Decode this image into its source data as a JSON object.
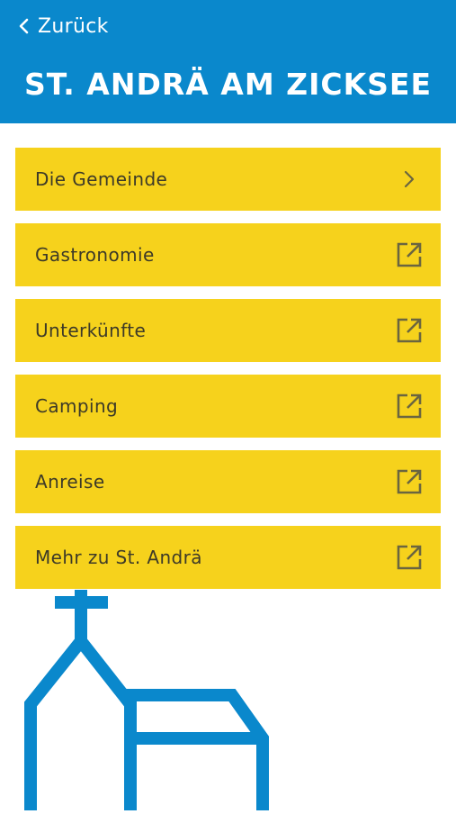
{
  "header": {
    "back_label": "Zurück",
    "title": "ST. ANDRÄ AM ZICKSEE",
    "background_color": "#0a88cc"
  },
  "menu": {
    "accent_color": "#f6d21c",
    "items": [
      {
        "label": "Die Gemeinde",
        "icon": "chevron-right-icon"
      },
      {
        "label": "Gastronomie",
        "icon": "external-link-icon"
      },
      {
        "label": "Unterkünfte",
        "icon": "external-link-icon"
      },
      {
        "label": "Camping",
        "icon": "external-link-icon"
      },
      {
        "label": "Anreise",
        "icon": "external-link-icon"
      },
      {
        "label": "Mehr zu St. Andrä",
        "icon": "external-link-icon"
      }
    ]
  },
  "illustration": {
    "icon": "church-illustration",
    "color": "#0a88cc"
  }
}
